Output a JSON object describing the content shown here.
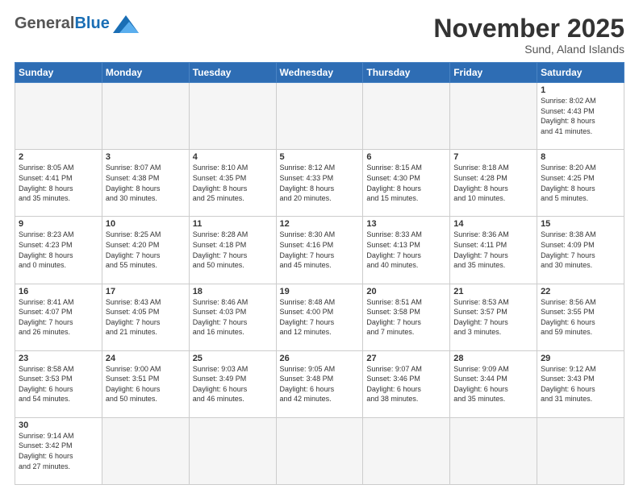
{
  "header": {
    "logo_general": "General",
    "logo_blue": "Blue",
    "month_year": "November 2025",
    "location": "Sund, Aland Islands"
  },
  "weekdays": [
    "Sunday",
    "Monday",
    "Tuesday",
    "Wednesday",
    "Thursday",
    "Friday",
    "Saturday"
  ],
  "weeks": [
    [
      {
        "day": "",
        "info": ""
      },
      {
        "day": "",
        "info": ""
      },
      {
        "day": "",
        "info": ""
      },
      {
        "day": "",
        "info": ""
      },
      {
        "day": "",
        "info": ""
      },
      {
        "day": "",
        "info": ""
      },
      {
        "day": "1",
        "info": "Sunrise: 8:02 AM\nSunset: 4:43 PM\nDaylight: 8 hours\nand 41 minutes."
      }
    ],
    [
      {
        "day": "2",
        "info": "Sunrise: 8:05 AM\nSunset: 4:41 PM\nDaylight: 8 hours\nand 35 minutes."
      },
      {
        "day": "3",
        "info": "Sunrise: 8:07 AM\nSunset: 4:38 PM\nDaylight: 8 hours\nand 30 minutes."
      },
      {
        "day": "4",
        "info": "Sunrise: 8:10 AM\nSunset: 4:35 PM\nDaylight: 8 hours\nand 25 minutes."
      },
      {
        "day": "5",
        "info": "Sunrise: 8:12 AM\nSunset: 4:33 PM\nDaylight: 8 hours\nand 20 minutes."
      },
      {
        "day": "6",
        "info": "Sunrise: 8:15 AM\nSunset: 4:30 PM\nDaylight: 8 hours\nand 15 minutes."
      },
      {
        "day": "7",
        "info": "Sunrise: 8:18 AM\nSunset: 4:28 PM\nDaylight: 8 hours\nand 10 minutes."
      },
      {
        "day": "8",
        "info": "Sunrise: 8:20 AM\nSunset: 4:25 PM\nDaylight: 8 hours\nand 5 minutes."
      }
    ],
    [
      {
        "day": "9",
        "info": "Sunrise: 8:23 AM\nSunset: 4:23 PM\nDaylight: 8 hours\nand 0 minutes."
      },
      {
        "day": "10",
        "info": "Sunrise: 8:25 AM\nSunset: 4:20 PM\nDaylight: 7 hours\nand 55 minutes."
      },
      {
        "day": "11",
        "info": "Sunrise: 8:28 AM\nSunset: 4:18 PM\nDaylight: 7 hours\nand 50 minutes."
      },
      {
        "day": "12",
        "info": "Sunrise: 8:30 AM\nSunset: 4:16 PM\nDaylight: 7 hours\nand 45 minutes."
      },
      {
        "day": "13",
        "info": "Sunrise: 8:33 AM\nSunset: 4:13 PM\nDaylight: 7 hours\nand 40 minutes."
      },
      {
        "day": "14",
        "info": "Sunrise: 8:36 AM\nSunset: 4:11 PM\nDaylight: 7 hours\nand 35 minutes."
      },
      {
        "day": "15",
        "info": "Sunrise: 8:38 AM\nSunset: 4:09 PM\nDaylight: 7 hours\nand 30 minutes."
      }
    ],
    [
      {
        "day": "16",
        "info": "Sunrise: 8:41 AM\nSunset: 4:07 PM\nDaylight: 7 hours\nand 26 minutes."
      },
      {
        "day": "17",
        "info": "Sunrise: 8:43 AM\nSunset: 4:05 PM\nDaylight: 7 hours\nand 21 minutes."
      },
      {
        "day": "18",
        "info": "Sunrise: 8:46 AM\nSunset: 4:03 PM\nDaylight: 7 hours\nand 16 minutes."
      },
      {
        "day": "19",
        "info": "Sunrise: 8:48 AM\nSunset: 4:00 PM\nDaylight: 7 hours\nand 12 minutes."
      },
      {
        "day": "20",
        "info": "Sunrise: 8:51 AM\nSunset: 3:58 PM\nDaylight: 7 hours\nand 7 minutes."
      },
      {
        "day": "21",
        "info": "Sunrise: 8:53 AM\nSunset: 3:57 PM\nDaylight: 7 hours\nand 3 minutes."
      },
      {
        "day": "22",
        "info": "Sunrise: 8:56 AM\nSunset: 3:55 PM\nDaylight: 6 hours\nand 59 minutes."
      }
    ],
    [
      {
        "day": "23",
        "info": "Sunrise: 8:58 AM\nSunset: 3:53 PM\nDaylight: 6 hours\nand 54 minutes."
      },
      {
        "day": "24",
        "info": "Sunrise: 9:00 AM\nSunset: 3:51 PM\nDaylight: 6 hours\nand 50 minutes."
      },
      {
        "day": "25",
        "info": "Sunrise: 9:03 AM\nSunset: 3:49 PM\nDaylight: 6 hours\nand 46 minutes."
      },
      {
        "day": "26",
        "info": "Sunrise: 9:05 AM\nSunset: 3:48 PM\nDaylight: 6 hours\nand 42 minutes."
      },
      {
        "day": "27",
        "info": "Sunrise: 9:07 AM\nSunset: 3:46 PM\nDaylight: 6 hours\nand 38 minutes."
      },
      {
        "day": "28",
        "info": "Sunrise: 9:09 AM\nSunset: 3:44 PM\nDaylight: 6 hours\nand 35 minutes."
      },
      {
        "day": "29",
        "info": "Sunrise: 9:12 AM\nSunset: 3:43 PM\nDaylight: 6 hours\nand 31 minutes."
      }
    ],
    [
      {
        "day": "30",
        "info": "Sunrise: 9:14 AM\nSunset: 3:42 PM\nDaylight: 6 hours\nand 27 minutes."
      },
      {
        "day": "",
        "info": ""
      },
      {
        "day": "",
        "info": ""
      },
      {
        "day": "",
        "info": ""
      },
      {
        "day": "",
        "info": ""
      },
      {
        "day": "",
        "info": ""
      },
      {
        "day": "",
        "info": ""
      }
    ]
  ]
}
